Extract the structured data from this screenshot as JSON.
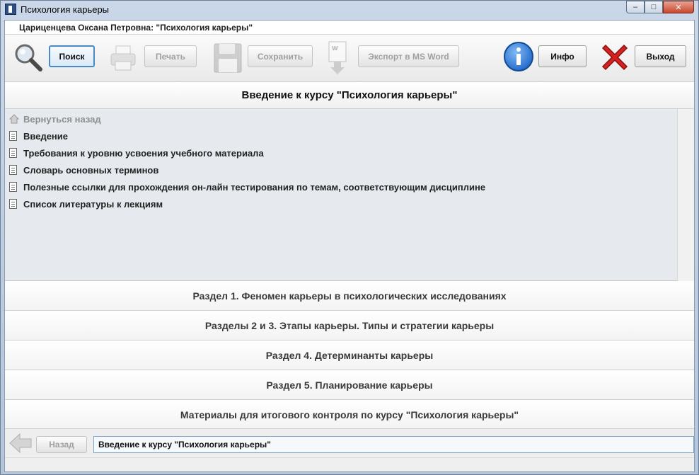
{
  "window": {
    "title": "Психология карьеры",
    "controls": {
      "minimize": "–",
      "maximize": "□",
      "close": "✕"
    }
  },
  "user_line": "Цариценцева Оксана Петровна: \"Психология карьеры\"",
  "toolbar": {
    "search_label": "Поиск",
    "print_label": "Печать",
    "save_label": "Сохранить",
    "export_label": "Экспорт в MS Word",
    "info_label": "Инфо",
    "exit_label": "Выход",
    "icons": [
      "search-icon",
      "printer-icon",
      "floppy-disk-icon",
      "word-export-icon",
      "info-icon",
      "exit-x-icon"
    ]
  },
  "section": {
    "title": "Введение к курсу \"Психология карьеры\""
  },
  "list": {
    "back_label": "Вернуться назад",
    "items": [
      "Введение",
      "Требования к уровню усвоения учебного материала",
      "Словарь основных терминов",
      "Полезные ссылки для прохождения он-лайн тестирования по темам, соответствующим дисциплине",
      "Список литературы к лекциям"
    ]
  },
  "sections": [
    "Раздел 1. Феномен карьеры в психологических  исследованиях",
    "Разделы 2 и 3. Этапы карьеры. Типы и стратегии карьеры",
    "Раздел 4. Детерминанты карьеры",
    "Раздел 5. Планирование карьеры",
    "Материалы для итогового контроля по курсу \"Психология карьеры\""
  ],
  "bottom": {
    "back_label": "Назад",
    "status_text": "Введение к курсу \"Психология карьеры\""
  },
  "colors": {
    "accent": "#4a8ac8",
    "info_blue": "#1f66c6",
    "exit_red": "#d42222"
  }
}
